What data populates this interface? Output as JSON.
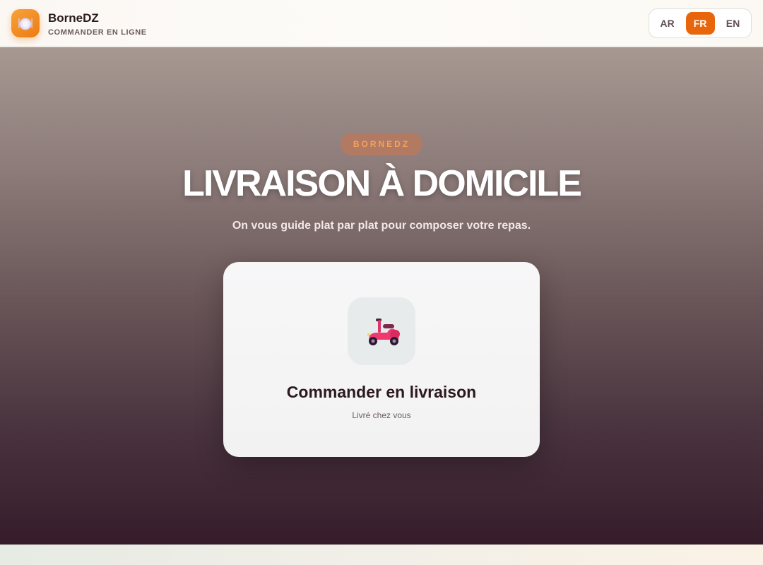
{
  "header": {
    "brand_name": "BorneDZ",
    "brand_subtitle": "COMMANDER EN LIGNE",
    "logo_icon": "plate-icon",
    "languages": [
      {
        "code": "AR",
        "active": false
      },
      {
        "code": "FR",
        "active": true
      },
      {
        "code": "EN",
        "active": false
      }
    ]
  },
  "hero": {
    "badge": "BORNEDZ",
    "title": "LIVRAISON À DOMICILE",
    "subtitle": "On vous guide plat par plat pour composer votre repas."
  },
  "card": {
    "icon": "scooter-icon",
    "title": "Commander en livraison",
    "subtitle": "Livré chez vous"
  },
  "colors": {
    "accent": "#e8650c",
    "brand_gradient_start": "#f7a23a",
    "hero_top": "#a79892",
    "hero_bottom": "#361c2a"
  }
}
